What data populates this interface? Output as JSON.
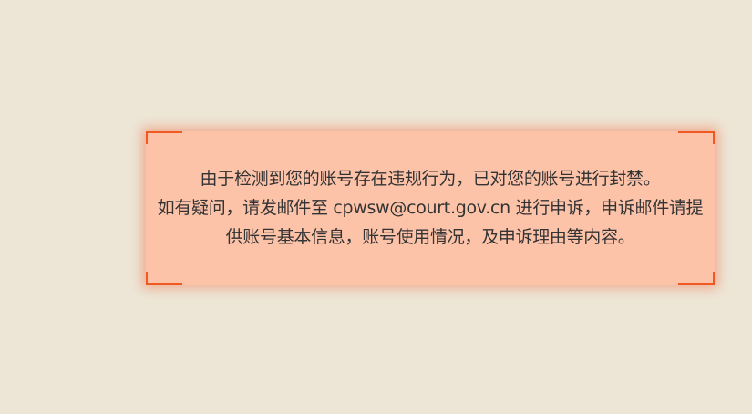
{
  "notice": {
    "line1": "由于检测到您的账号存在违规行为，已对您的账号进行封禁。",
    "line2": "如有疑问，请发邮件至 cpwsw@court.gov.cn 进行申诉，申诉邮件请提",
    "line3": "供账号基本信息，账号使用情况，及申诉理由等内容。"
  },
  "colors": {
    "page_background": "#ede6d7",
    "notice_background": "#fdc3a9",
    "accent": "#ef5a24",
    "text": "#333333"
  }
}
